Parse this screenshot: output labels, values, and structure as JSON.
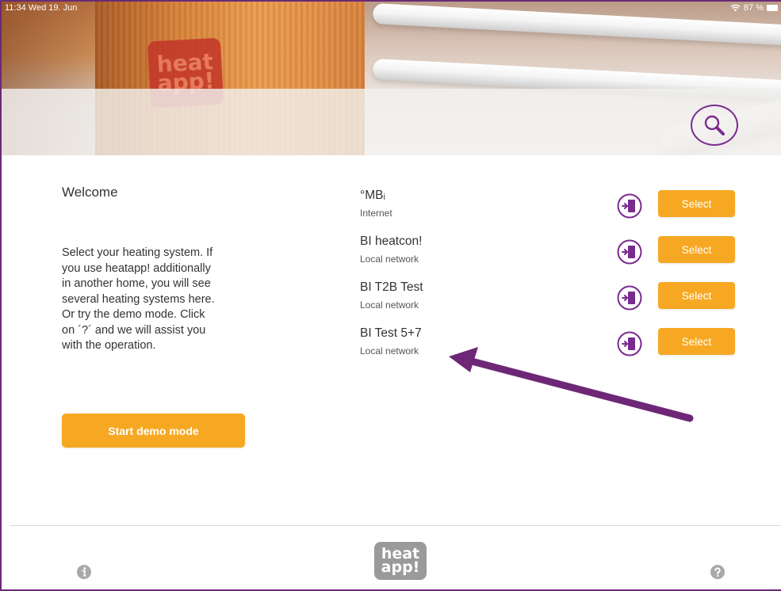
{
  "status_bar": {
    "time": "11:34  Wed 19. Jun",
    "battery": "87 %"
  },
  "brand": {
    "logo_top": "heat",
    "logo_bottom": "app!"
  },
  "colors": {
    "accent": "#f7a823",
    "brand_purple": "#7a2b8f",
    "arrow": "#6e2777"
  },
  "welcome": {
    "title": "Welcome",
    "lines": [
      "Select your heating system. If",
      "you use heatapp! additionally",
      "in another home, you will see",
      "several heating systems here.",
      "Or try the demo mode. Click",
      "on ´?´ and we will assist you",
      "with the operation."
    ],
    "demo_button": "Start demo mode"
  },
  "systems": [
    {
      "name": "°MBᵢ",
      "connection": "Internet",
      "select_label": "Select"
    },
    {
      "name": "BI heatcon!",
      "connection": "Local network",
      "select_label": "Select"
    },
    {
      "name": "BI T2B Test",
      "connection": "Local network",
      "select_label": "Select"
    },
    {
      "name": "BI Test 5+7",
      "connection": "Local network",
      "select_label": "Select"
    }
  ],
  "icons": {
    "search": "search-icon",
    "login": "login-door-icon",
    "info": "info-icon",
    "help": "help-icon",
    "wifi": "wifi-icon",
    "battery": "battery-icon"
  }
}
